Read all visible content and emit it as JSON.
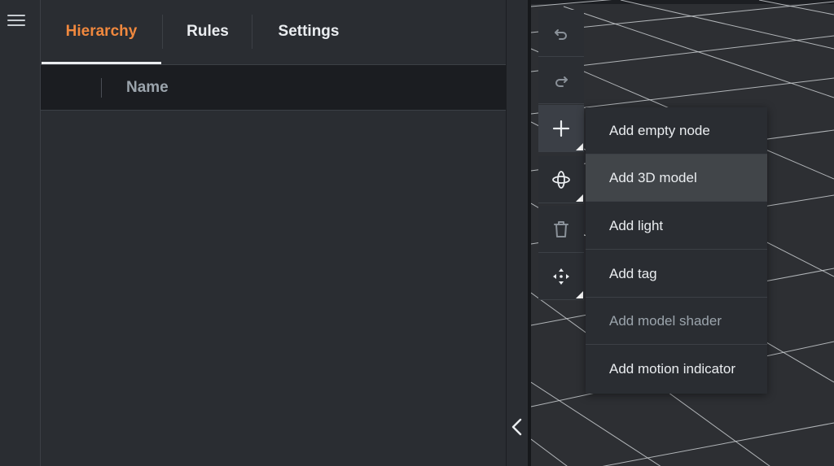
{
  "tabs": [
    {
      "label": "Hierarchy",
      "active": true
    },
    {
      "label": "Rules",
      "active": false
    },
    {
      "label": "Settings",
      "active": false
    }
  ],
  "table": {
    "columns": [
      "Name"
    ]
  },
  "toolbar": {
    "tools": [
      {
        "name": "undo-icon"
      },
      {
        "name": "redo-icon"
      },
      {
        "name": "add-icon",
        "selected": true
      },
      {
        "name": "orbit-icon"
      },
      {
        "name": "delete-icon"
      },
      {
        "name": "move-icon"
      }
    ]
  },
  "add_menu": {
    "items": [
      {
        "label": "Add empty node",
        "state": "normal"
      },
      {
        "label": "Add 3D model",
        "state": "hover"
      },
      {
        "label": "Add light",
        "state": "normal"
      },
      {
        "label": "Add tag",
        "state": "normal"
      },
      {
        "label": "Add model shader",
        "state": "disabled"
      },
      {
        "label": "Add motion indicator",
        "state": "normal"
      }
    ]
  },
  "colors": {
    "accent": "#f0883e",
    "panel_bg": "#2a2d32",
    "header_bg": "#1b1d21",
    "viewport_bg": "#2d2f33",
    "grid_line": "#c9ccd0"
  }
}
